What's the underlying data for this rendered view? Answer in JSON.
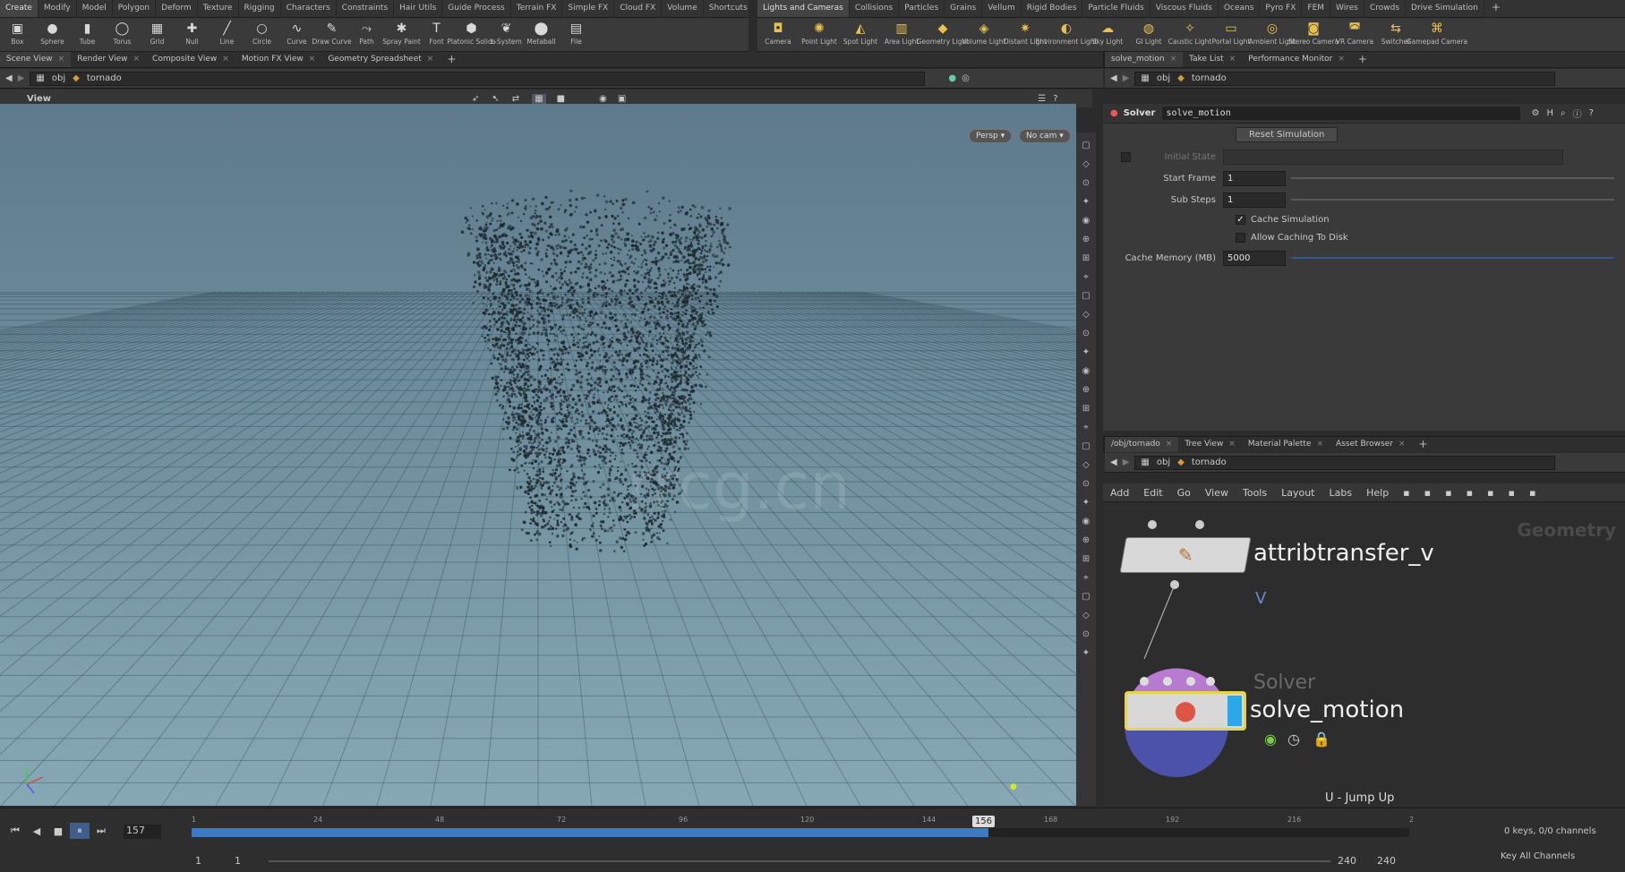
{
  "shelf_tabs_left": [
    "Create",
    "Modify",
    "Model",
    "Polygon",
    "Deform",
    "Texture",
    "Rigging",
    "Characters",
    "Constraints",
    "Hair Utils",
    "Guide Process",
    "Terrain FX",
    "Simple FX",
    "Cloud FX",
    "Volume",
    "Shortcuts"
  ],
  "shelf_tabs_right": [
    "Lights and Cameras",
    "Collisions",
    "Particles",
    "Grains",
    "Vellum",
    "Rigid Bodies",
    "Particle Fluids",
    "Viscous Fluids",
    "Oceans",
    "Pyro FX",
    "FEM",
    "Wires",
    "Crowds",
    "Drive Simulation"
  ],
  "tools_left": [
    {
      "label": "Box",
      "icon": "box-icon"
    },
    {
      "label": "Sphere",
      "icon": "sphere-icon"
    },
    {
      "label": "Tube",
      "icon": "tube-icon"
    },
    {
      "label": "Torus",
      "icon": "torus-icon"
    },
    {
      "label": "Grid",
      "icon": "grid-icon"
    },
    {
      "label": "Null",
      "icon": "null-icon"
    },
    {
      "label": "Line",
      "icon": "line-icon"
    },
    {
      "label": "Circle",
      "icon": "circle-icon"
    },
    {
      "label": "Curve",
      "icon": "curve-icon"
    },
    {
      "label": "Draw Curve",
      "icon": "draw-curve-icon"
    },
    {
      "label": "Path",
      "icon": "path-icon"
    },
    {
      "label": "Spray Paint",
      "icon": "spray-paint-icon"
    },
    {
      "label": "Font",
      "icon": "font-icon"
    },
    {
      "label": "Platonic Solids",
      "icon": "platonic-icon"
    },
    {
      "label": "L-System",
      "icon": "lsystem-icon"
    },
    {
      "label": "Metaball",
      "icon": "metaball-icon"
    },
    {
      "label": "File",
      "icon": "file-icon"
    }
  ],
  "tools_right": [
    {
      "label": "Camera",
      "icon": "camera-icon"
    },
    {
      "label": "Point Light",
      "icon": "point-light-icon"
    },
    {
      "label": "Spot Light",
      "icon": "spot-light-icon"
    },
    {
      "label": "Area Light",
      "icon": "area-light-icon"
    },
    {
      "label": "Geometry Light",
      "icon": "geometry-light-icon"
    },
    {
      "label": "Volume Light",
      "icon": "volume-light-icon"
    },
    {
      "label": "Distant Light",
      "icon": "distant-light-icon"
    },
    {
      "label": "Environment Light",
      "icon": "environment-light-icon"
    },
    {
      "label": "Sky Light",
      "icon": "sky-light-icon"
    },
    {
      "label": "GI Light",
      "icon": "gi-light-icon"
    },
    {
      "label": "Caustic Light",
      "icon": "caustic-light-icon"
    },
    {
      "label": "Portal Light",
      "icon": "portal-light-icon"
    },
    {
      "label": "Ambient Light",
      "icon": "ambient-light-icon"
    },
    {
      "label": "Stereo Camera",
      "icon": "stereo-camera-icon"
    },
    {
      "label": "VR Camera",
      "icon": "vr-camera-icon"
    },
    {
      "label": "Switcher",
      "icon": "switcher-icon"
    },
    {
      "label": "Gamepad Camera",
      "icon": "gamepad-camera-icon"
    }
  ],
  "left_pane_tabs": [
    "Scene View",
    "Render View",
    "Composite View",
    "Motion FX View",
    "Geometry Spreadsheet"
  ],
  "right_pane_tabs": [
    "solve_motion",
    "Take List",
    "Performance Monitor"
  ],
  "path": {
    "root": "obj",
    "node": "tornado"
  },
  "viewport": {
    "label": "View",
    "persp": "Persp ▾",
    "cam": "No cam ▾",
    "watermark": "rrcg.cn"
  },
  "params": {
    "type": "Solver",
    "name": "solve_motion",
    "reset_button": "Reset Simulation",
    "initial_state_label": "Initial State",
    "start_frame_label": "Start Frame",
    "start_frame": "1",
    "sub_steps_label": "Sub Steps",
    "sub_steps": "1",
    "cache_sim_label": "Cache Simulation",
    "cache_sim": true,
    "allow_cache_label": "Allow Caching To Disk",
    "allow_cache": false,
    "cache_mem_label": "Cache Memory (MB)",
    "cache_mem": "5000"
  },
  "net_tabs": [
    "/obj/tornado",
    "Tree View",
    "Material Palette",
    "Asset Browser"
  ],
  "net_menu": [
    "Add",
    "Edit",
    "Go",
    "View",
    "Tools",
    "Layout",
    "Labs",
    "Help"
  ],
  "network": {
    "context": "Geometry",
    "node1_name": "attribtransfer_v",
    "node1_comment": "V",
    "node2_type": "Solver",
    "node2_name": "solve_motion",
    "hint": "U - Jump Up"
  },
  "timeline": {
    "current_frame": "157",
    "marker": "156",
    "ticks": [
      "1",
      "24",
      "48",
      "72",
      "96",
      "120",
      "144",
      "168",
      "192",
      "216",
      "2"
    ],
    "start": "1",
    "start2": "1",
    "end": "240",
    "end2": "240",
    "keys": "0 keys, 0/0 channels",
    "key_all": "Key All Channels"
  }
}
